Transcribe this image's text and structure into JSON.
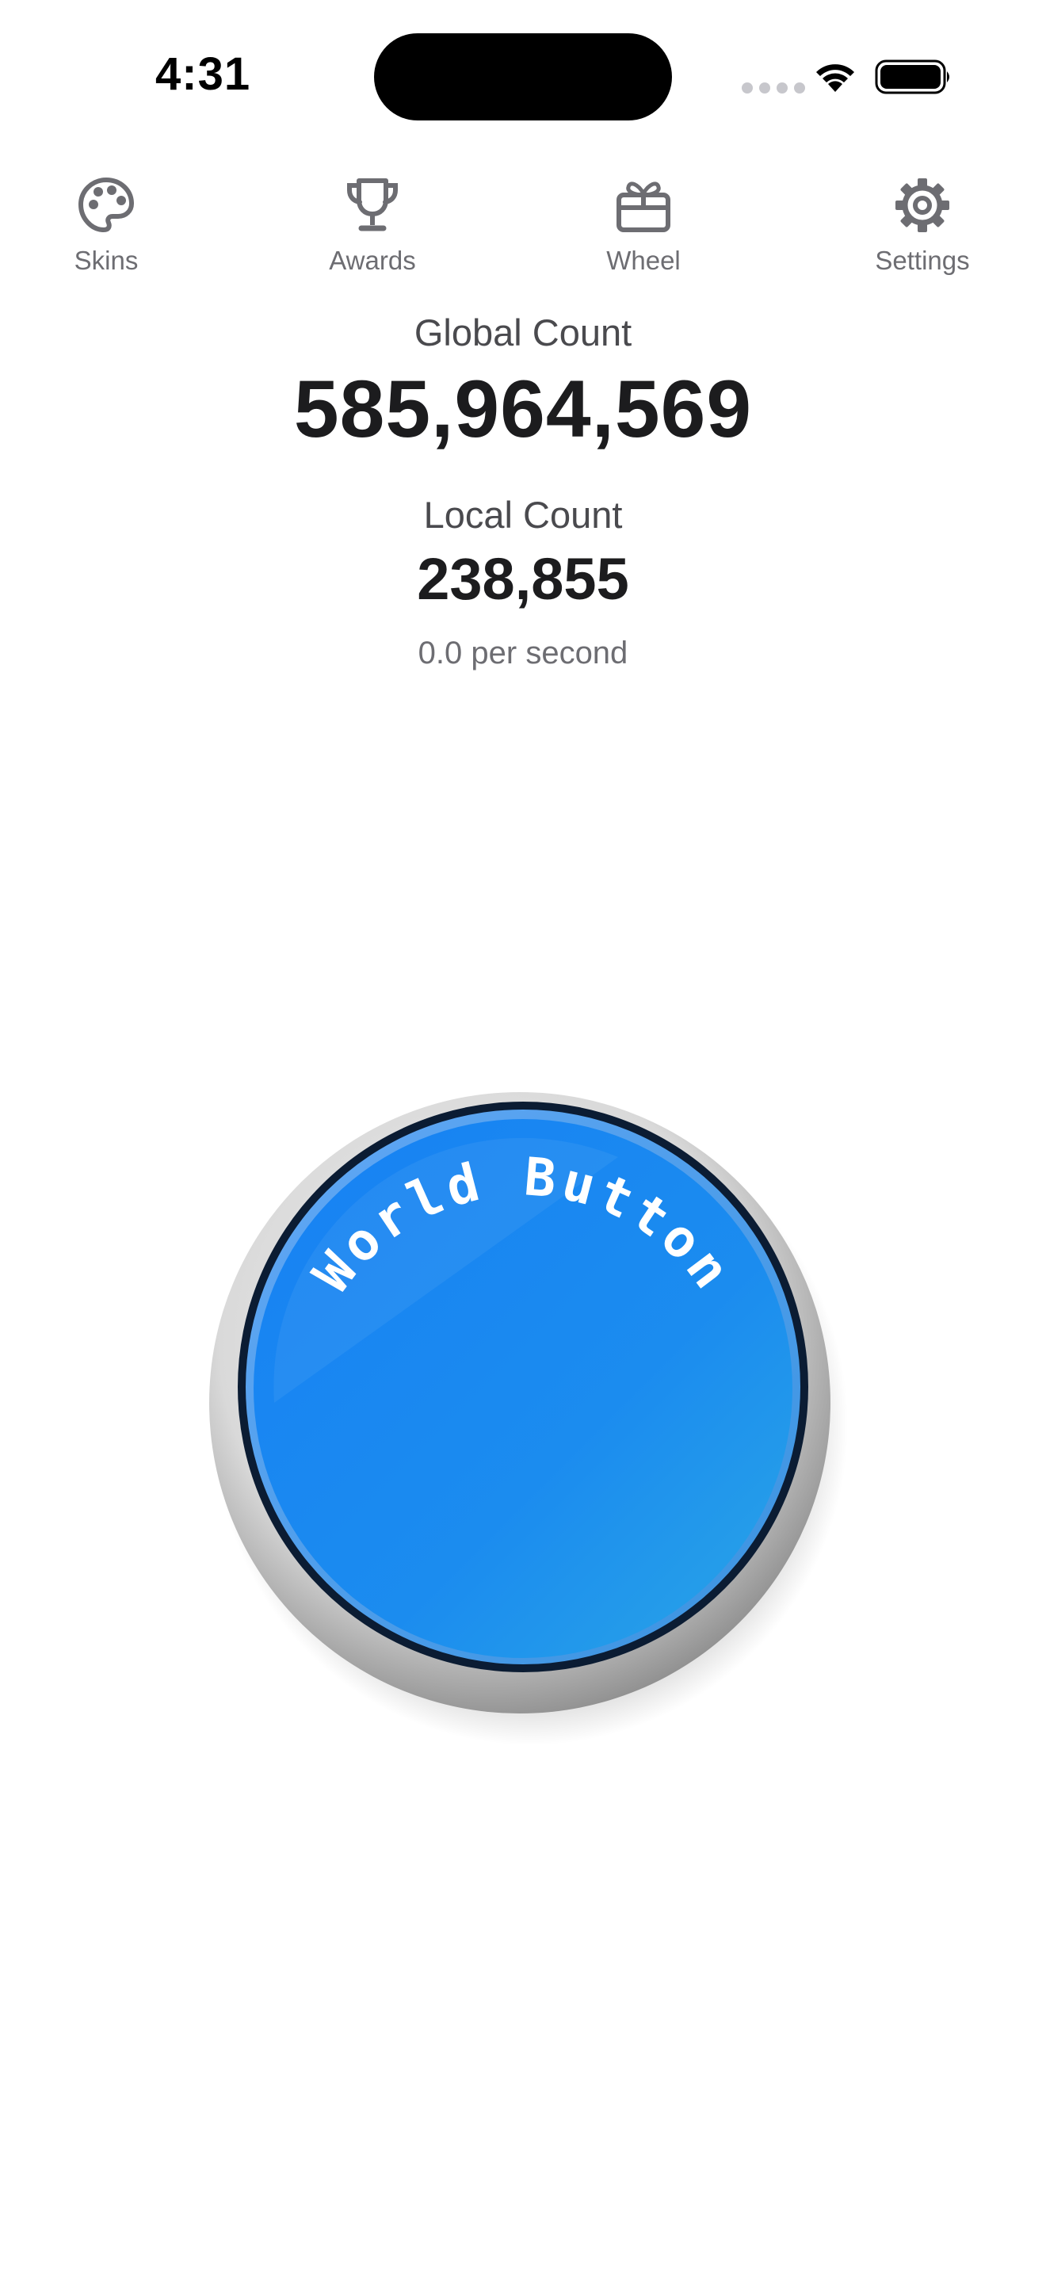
{
  "status_bar": {
    "time": "4:31"
  },
  "nav": {
    "items": [
      {
        "label": "Skins",
        "icon": "palette-icon"
      },
      {
        "label": "Awards",
        "icon": "trophy-icon"
      },
      {
        "label": "Wheel",
        "icon": "gift-icon"
      },
      {
        "label": "Settings",
        "icon": "gear-icon"
      }
    ]
  },
  "counts": {
    "global_label": "Global Count",
    "global_value": "585,964,569",
    "local_label": "Local Count",
    "local_value": "238,855",
    "rate": "0.0 per second"
  },
  "world_button": {
    "label": "World Button",
    "color": "#1a8cf0"
  }
}
